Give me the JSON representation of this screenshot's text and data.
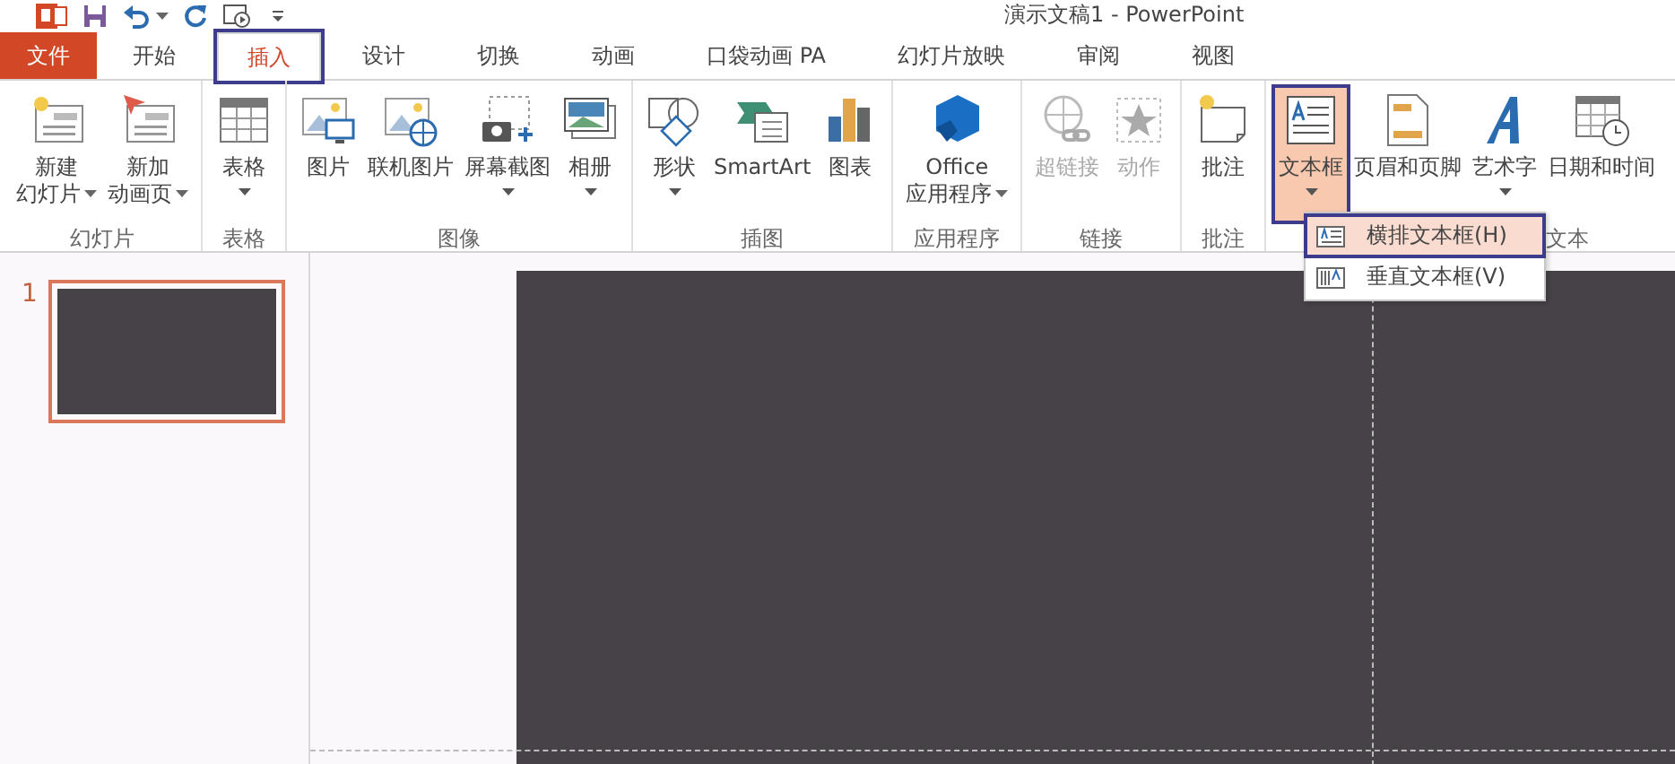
{
  "window": {
    "title": "演示文稿1 - PowerPoint"
  },
  "quick_access": [
    {
      "kind": "save",
      "dropdown": false
    },
    {
      "kind": "undo",
      "dropdown": true
    },
    {
      "kind": "redo",
      "dropdown": false
    },
    {
      "kind": "slideshow",
      "dropdown": false
    },
    {
      "kind": "customize",
      "dropdown": false
    }
  ],
  "file_tab": {
    "label": "文件"
  },
  "tabs": [
    {
      "label": "开始",
      "selected": false,
      "annotated": false
    },
    {
      "label": "插入",
      "selected": true,
      "annotated": true
    },
    {
      "label": "设计",
      "selected": false,
      "annotated": false
    },
    {
      "label": "切换",
      "selected": false,
      "annotated": false
    },
    {
      "label": "动画",
      "selected": false,
      "annotated": false
    },
    {
      "label": "口袋动画 PA",
      "selected": false,
      "annotated": false
    },
    {
      "label": "幻灯片放映",
      "selected": false,
      "annotated": false
    },
    {
      "label": "审阅",
      "selected": false,
      "annotated": false
    },
    {
      "label": "视图",
      "selected": false,
      "annotated": false
    }
  ],
  "ribbon_groups": [
    {
      "label": "幻灯片",
      "buttons": [
        {
          "kind": "new-slide",
          "lines": [
            "新建",
            "幻灯片"
          ],
          "dropdown": true,
          "disabled": false,
          "active": false,
          "annotated": false
        },
        {
          "kind": "anim-page",
          "lines": [
            "新加",
            "动画页"
          ],
          "dropdown": true,
          "disabled": false,
          "active": false,
          "annotated": false
        }
      ]
    },
    {
      "label": "表格",
      "buttons": [
        {
          "kind": "table",
          "lines": [
            "表格"
          ],
          "dropdown": true,
          "disabled": false,
          "active": false,
          "annotated": false
        }
      ]
    },
    {
      "label": "图像",
      "buttons": [
        {
          "kind": "picture",
          "lines": [
            "图片"
          ],
          "dropdown": false,
          "disabled": false,
          "active": false,
          "annotated": false
        },
        {
          "kind": "online-picture",
          "lines": [
            "联机图片"
          ],
          "dropdown": false,
          "disabled": false,
          "active": false,
          "annotated": false
        },
        {
          "kind": "screenshot",
          "lines": [
            "屏幕截图"
          ],
          "dropdown": true,
          "disabled": false,
          "active": false,
          "annotated": false
        },
        {
          "kind": "album",
          "lines": [
            "相册"
          ],
          "dropdown": true,
          "disabled": false,
          "active": false,
          "annotated": false
        }
      ]
    },
    {
      "label": "插图",
      "buttons": [
        {
          "kind": "shapes",
          "lines": [
            "形状"
          ],
          "dropdown": true,
          "disabled": false,
          "active": false,
          "annotated": false
        },
        {
          "kind": "smartart",
          "lines": [
            "SmartArt"
          ],
          "dropdown": false,
          "disabled": false,
          "active": false,
          "annotated": false
        },
        {
          "kind": "chart",
          "lines": [
            "图表"
          ],
          "dropdown": false,
          "disabled": false,
          "active": false,
          "annotated": false
        }
      ]
    },
    {
      "label": "应用程序",
      "buttons": [
        {
          "kind": "office",
          "lines": [
            "Office",
            "应用程序"
          ],
          "dropdown": true,
          "disabled": false,
          "active": false,
          "annotated": false
        }
      ]
    },
    {
      "label": "链接",
      "buttons": [
        {
          "kind": "hyperlink",
          "lines": [
            "超链接"
          ],
          "dropdown": false,
          "disabled": true,
          "active": false,
          "annotated": false
        },
        {
          "kind": "action",
          "lines": [
            "动作"
          ],
          "dropdown": false,
          "disabled": true,
          "active": false,
          "annotated": false
        }
      ]
    },
    {
      "label": "批注",
      "buttons": [
        {
          "kind": "comment",
          "lines": [
            "批注"
          ],
          "dropdown": false,
          "disabled": false,
          "active": false,
          "annotated": false
        }
      ]
    },
    {
      "label": "文本",
      "buttons": [
        {
          "kind": "textbox",
          "lines": [
            "文本框"
          ],
          "dropdown": true,
          "disabled": false,
          "active": true,
          "annotated": true
        },
        {
          "kind": "header-footer",
          "lines": [
            "页眉和页脚"
          ],
          "dropdown": false,
          "disabled": false,
          "active": false,
          "annotated": false
        },
        {
          "kind": "wordart",
          "lines": [
            "艺术字"
          ],
          "dropdown": true,
          "disabled": false,
          "active": false,
          "annotated": false
        },
        {
          "kind": "datetime",
          "lines": [
            "日期和时间"
          ],
          "dropdown": false,
          "disabled": false,
          "active": false,
          "annotated": false
        }
      ]
    }
  ],
  "textbox_menu": [
    {
      "kind": "horizontal",
      "label": "横排文本框(H)",
      "selected": true,
      "annotated": true
    },
    {
      "kind": "vertical",
      "label": "垂直文本框(V)",
      "selected": false,
      "annotated": false
    }
  ],
  "slides": [
    {
      "number": "1",
      "selected": true
    }
  ]
}
